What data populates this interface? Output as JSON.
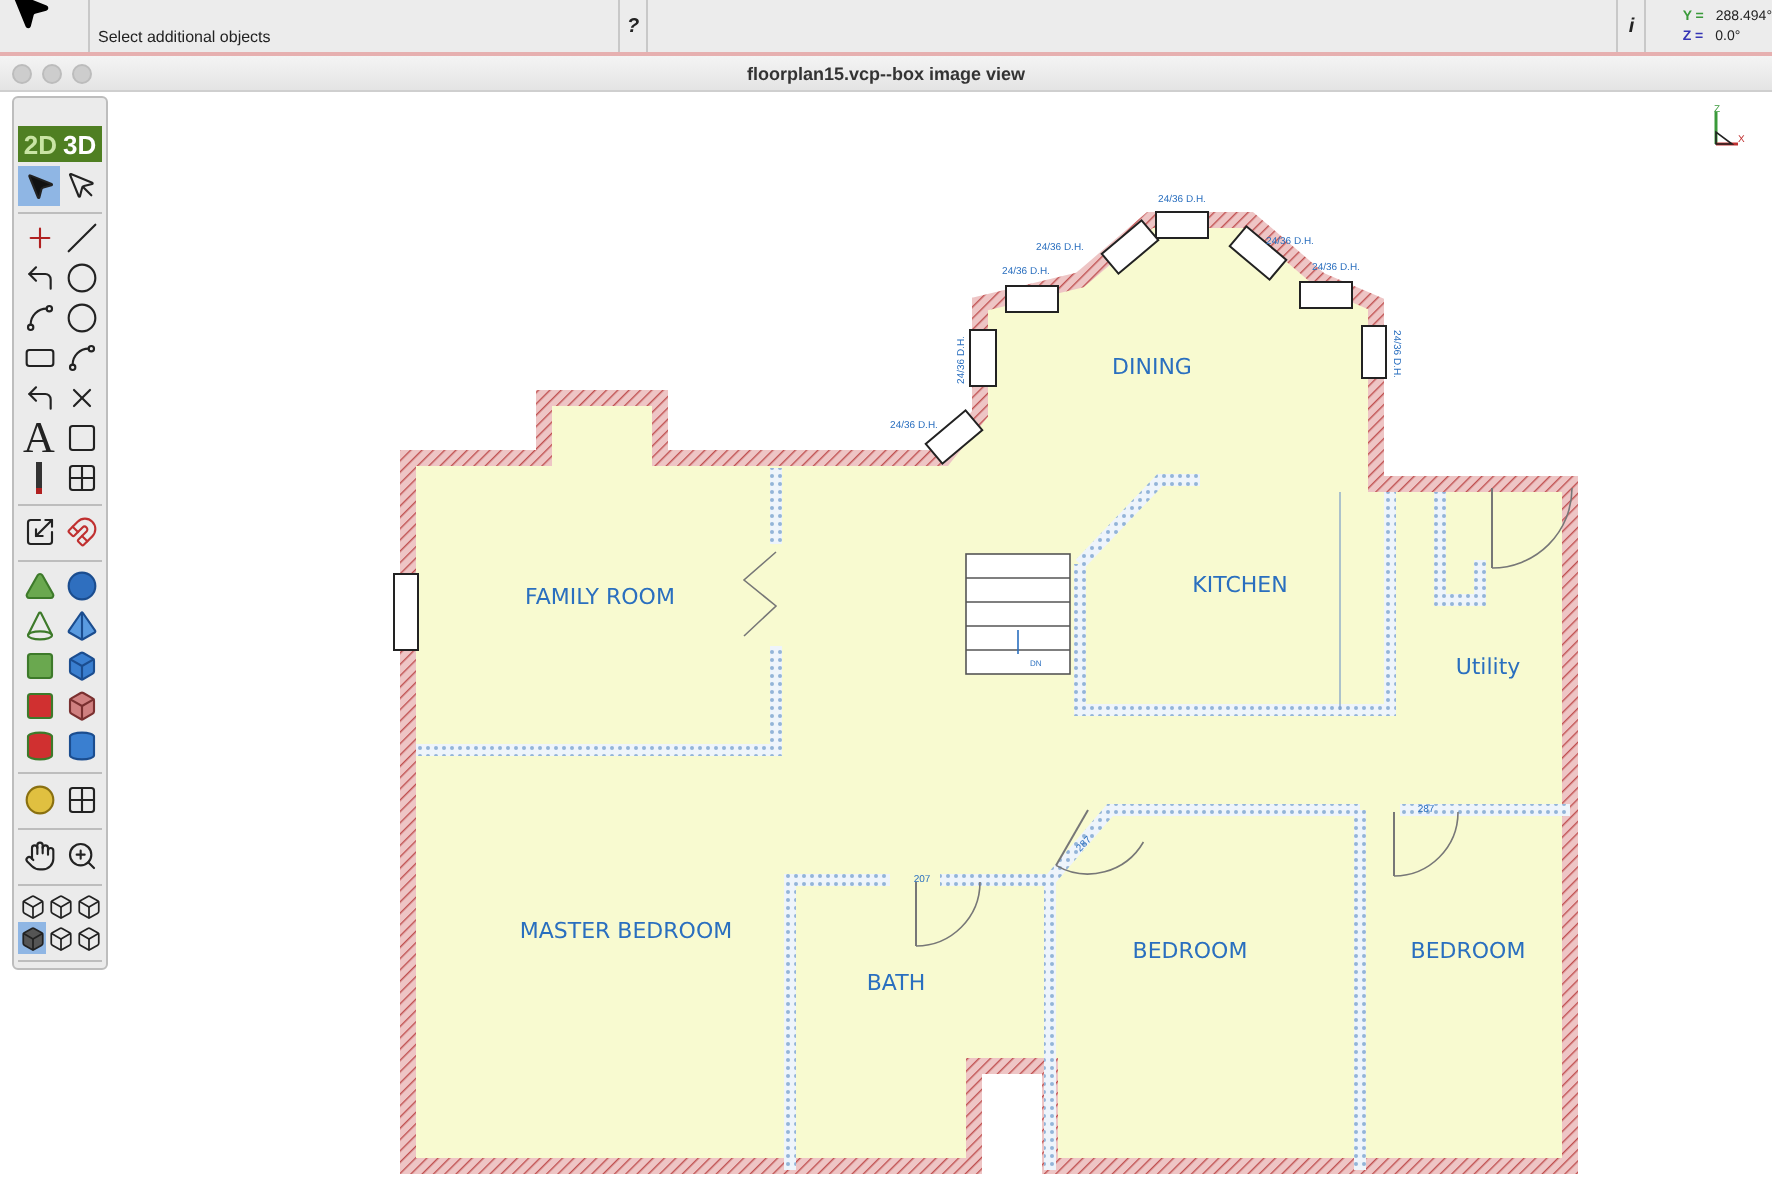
{
  "info_bar": {
    "hint": "Select additional objects",
    "help": "?",
    "info": "i",
    "coordinates": [
      {
        "axis": "Y =",
        "value": "288.494°",
        "color": "#3a9a3a"
      },
      {
        "axis": "Z =",
        "value": "0.0°",
        "color": "#3535b5"
      }
    ]
  },
  "window": {
    "title": "floorplan15.vcp--box image view"
  },
  "palette": {
    "modes": [
      {
        "label": "2D",
        "selected": false
      },
      {
        "label": "3D",
        "selected": true
      }
    ],
    "sections": [
      [
        {
          "selected": true
        },
        {
          "selected": false
        }
      ],
      [
        {
          "selected": false
        },
        {
          "selected": false
        },
        {
          "selected": false
        },
        {
          "selected": false
        },
        {
          "selected": false
        },
        {
          "selected": false
        },
        {
          "selected": false
        },
        {
          "selected": false
        },
        {
          "selected": false
        },
        {
          "selected": false
        },
        {
          "glyph": "A",
          "selected": false
        },
        {
          "selected": false
        },
        {
          "selected": false
        },
        {
          "selected": false
        }
      ],
      [
        {
          "selected": false
        },
        {
          "selected": false
        }
      ],
      [
        {
          "selected": false
        },
        {
          "selected": false
        },
        {
          "selected": false
        },
        {
          "selected": false
        },
        {
          "selected": false
        },
        {
          "selected": false
        },
        {
          "selected": false
        },
        {
          "selected": false
        },
        {
          "selected": false
        },
        {
          "selected": false
        }
      ],
      [
        {
          "selected": false
        },
        {
          "selected": false
        }
      ],
      [
        {
          "selected": false
        },
        {
          "selected": false
        }
      ],
      [
        {
          "selected": false
        },
        {
          "selected": false
        },
        {
          "selected": false
        },
        {
          "selected": true
        },
        {
          "selected": false
        },
        {
          "selected": false
        }
      ]
    ]
  },
  "axis_gizmo": {
    "labels": [
      "Z",
      "X"
    ]
  },
  "plan": {
    "rooms": [
      "DINING",
      "FAMILY ROOM",
      "KITCHEN",
      "Utility",
      "MASTER BEDROOM",
      "BATH",
      "BEDROOM",
      "BEDROOM"
    ],
    "window_labels": [
      "24/36 D.H.",
      "24/36 D.H.",
      "24/36 D.H.",
      "24/36 D.H.",
      "24/36 D.H.",
      "24/36 D.H.",
      "24/36 D.H.",
      "24/36 D.H."
    ],
    "door_labels": [
      "207",
      "287",
      "287"
    ],
    "stair_label": "DN"
  }
}
